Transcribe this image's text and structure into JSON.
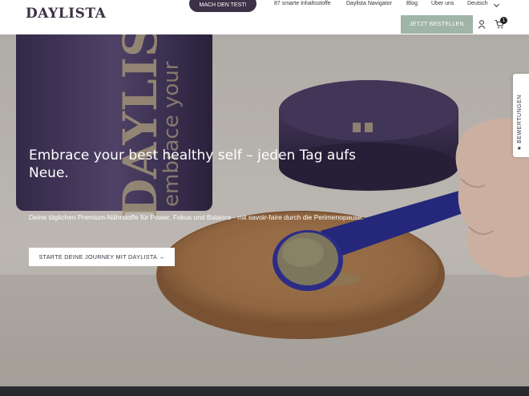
{
  "header": {
    "logo": "DAYLISTA",
    "test_button": "MACH DEN TEST!",
    "nav": [
      "87 smarte Inhaltsstoffe",
      "Daylista Navigator",
      "Blog",
      "Über uns",
      "Deutsch"
    ],
    "order_button": "JETZT BESTELLEN",
    "cart_count": "1",
    "icons": [
      "user-icon",
      "cart-icon",
      "chevron-down-icon"
    ]
  },
  "hero": {
    "title": "Embrace your best healthy self – jeden Tag aufs Neue.",
    "subtitle": "Deine täglichen Premium-Nährstoffe für Power, Fokus und Balance - mit savoir-faire durch die Perimenopause.",
    "cta": "STARTE DEINE JOURNEY MIT DAYLISTA →",
    "jar_brand": "DAYLISTA",
    "jar_tagline": "embrace your"
  },
  "review_tab": {
    "label": "★ BEWERTUNGEN"
  },
  "colors": {
    "brand": "#3b3244",
    "accent_green": "#9fb5a6",
    "cta_dark": "#3c3147"
  }
}
